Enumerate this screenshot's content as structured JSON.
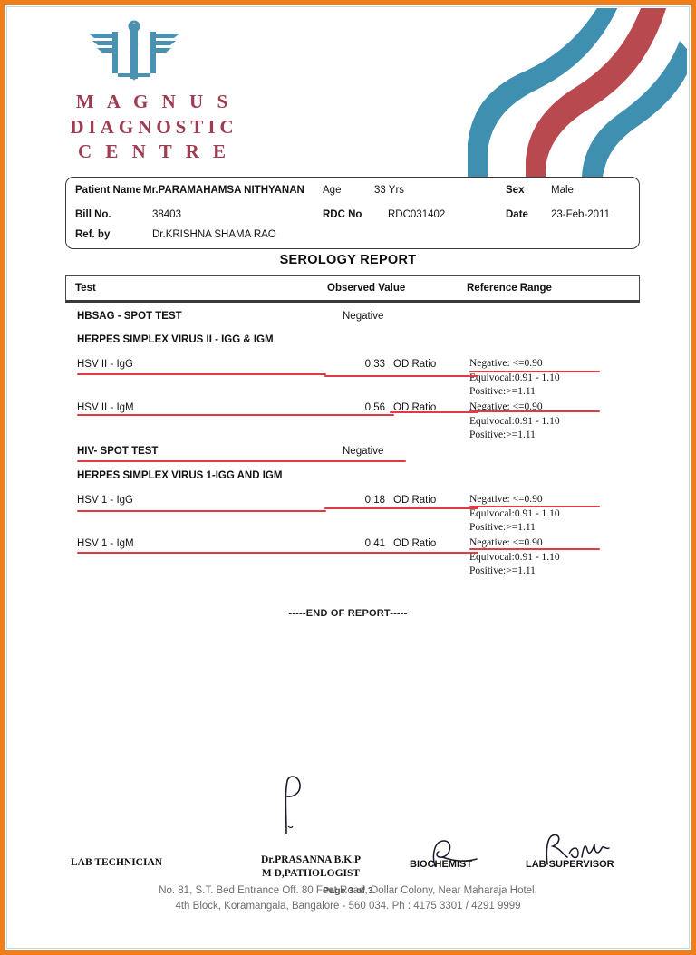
{
  "brand": {
    "line1": "M A G N U S",
    "line2": "DIAGNOSTIC",
    "line3": "C E N T R E",
    "logo_icon": "caduceus-icon",
    "accent_maroon": "#9e3c52",
    "accent_teal": "#3f8fb0",
    "accent_red": "#b8494f",
    "border_orange": "#ef7f1a"
  },
  "patient": {
    "name_label": "Patient Name",
    "name_value": "Mr.PARAMAHAMSA NITHYANAN",
    "age_label": "Age",
    "age_value": "33  Yrs",
    "sex_label": "Sex",
    "sex_value": "Male",
    "bill_label": "Bill No.",
    "bill_value": "38403",
    "rdc_label": "RDC No",
    "rdc_value": "RDC031402",
    "date_label": "Date",
    "date_value": "23-Feb-2011",
    "ref_label": "Ref. by",
    "ref_value": "Dr.KRISHNA SHAMA RAO"
  },
  "report": {
    "title": "SEROLOGY REPORT",
    "columns": {
      "test": "Test",
      "observed": "Observed Value",
      "reference": "Reference Range"
    },
    "end_marker": "-----END OF REPORT-----"
  },
  "reference_standard": {
    "negative": "Negative: <=0.90",
    "equivocal": "Equivocal:0.91 - 1.10",
    "positive": "Positive:>=1.11"
  },
  "rows": [
    {
      "kind": "section",
      "name": "HBSAG - SPOT TEST",
      "observed_text": "Negative"
    },
    {
      "kind": "section",
      "name": "HERPES SIMPLEX VIRUS II - IGG & IGM"
    },
    {
      "kind": "result",
      "name": "HSV II - IgG",
      "value": "0.33",
      "unit": "OD Ratio"
    },
    {
      "kind": "result",
      "name": "HSV II - IgM",
      "value": "0.56",
      "unit": "OD Ratio"
    },
    {
      "kind": "section",
      "name": "HIV- SPOT TEST",
      "observed_text": "Negative"
    },
    {
      "kind": "section",
      "name": "HERPES SIMPLEX VIRUS 1-IGG AND IGM"
    },
    {
      "kind": "result",
      "name": "HSV 1 - IgG",
      "value": "0.18",
      "unit": "OD Ratio"
    },
    {
      "kind": "result",
      "name": "HSV 1 - IgM",
      "value": "0.41",
      "unit": "OD Ratio"
    }
  ],
  "signatures": {
    "lab_technician": "LAB TECHNICIAN",
    "pathologist_name": "Dr.PRASANNA B.K.P",
    "pathologist_qual": "M D,PATHOLOGIST",
    "biochemist": "BIOCHEMIST",
    "lab_supervisor": "LAB SUPERVISOR"
  },
  "footer": {
    "address_line1": "No. 81, S.T. Bed Entrance Off. 80 Feet Road, Dollar Colony, Near Maharaja Hotel,",
    "address_line2": "4th Block, Koramangala, Bangalore - 560 034. Ph : 4175 3301 / 4291 9999",
    "page_stamp": "Page 3 of 3"
  }
}
